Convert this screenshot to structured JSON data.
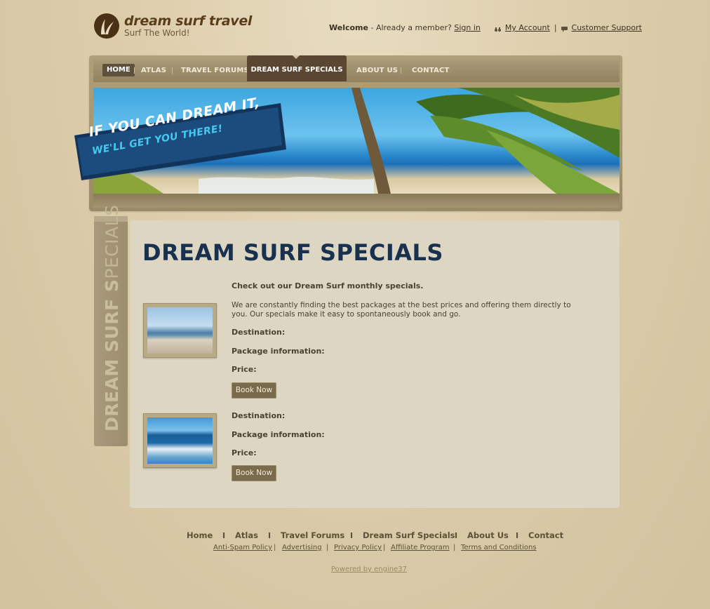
{
  "brand": {
    "name": "dream surf travel",
    "tagline": "Surf The World!"
  },
  "topbar": {
    "welcome": "Welcome",
    "member_text": " - Already a member? ",
    "sign_in": "Sign in",
    "my_account": "My Account",
    "separator": "|",
    "support": "Customer Support"
  },
  "nav": {
    "items": [
      "HOME",
      "ATLAS",
      "TRAVEL FORUMS",
      "DREAM SURF SPECIALS",
      "ABOUT US",
      "CONTACT"
    ],
    "active": "DREAM SURF SPECIALS"
  },
  "banner": {
    "line1": "IF YOU CAN DREAM IT,",
    "line2": "WE'LL GET YOU THERE!"
  },
  "side_tab": {
    "bold": "DREAM SURF S",
    "light": "PECIALS"
  },
  "main": {
    "title": "DREAM SURF SPECIALS",
    "intro_heading": "Check out our Dream Surf monthly specials.",
    "intro_text": "We are constantly finding the best packages at the best prices and offering them directly to you. Our specials make it easy to spontaneously book and go.",
    "packages": [
      {
        "destination": "Destination:",
        "package_info": "Package information:",
        "price": "Price:",
        "button": "Book Now"
      },
      {
        "destination": "Destination:",
        "package_info": "Package information:",
        "price": "Price:",
        "button": "Book Now"
      }
    ]
  },
  "footer": {
    "nav": [
      "Home",
      "Atlas",
      "Travel Forums",
      "Dream Surf Specials",
      "About Us",
      "Contact"
    ],
    "nav_separator": "I",
    "links": [
      "Anti-Spam Policy",
      "Advertising",
      "Privacy Policy",
      "Affiliate Program",
      "Terms and Conditions"
    ],
    "link_separator": "|",
    "powered_by": "Powered by engine37"
  },
  "colors": {
    "background": "#d8c9a6",
    "nav_active": "#5b4632",
    "title": "#18314f",
    "button": "#7b6b4d",
    "panel": "#dcd6c3"
  },
  "icons": [
    "logo-icon",
    "binoculars-icon",
    "speech-bubble-icon"
  ]
}
